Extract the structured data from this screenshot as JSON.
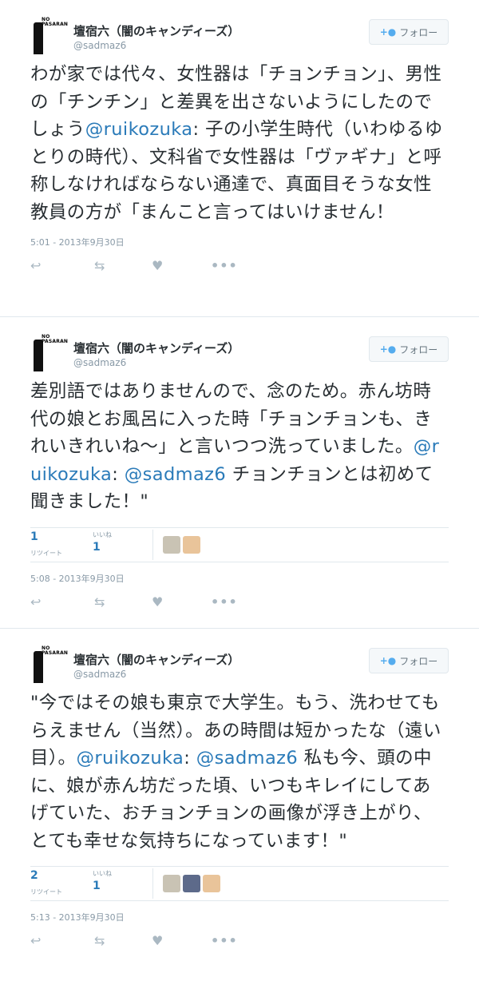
{
  "tweets": [
    {
      "name": "壇宿六（闇のキャンディーズ）",
      "handle": "@sadmaz6",
      "follow_label": "フォロー",
      "text_parts": [
        {
          "t": "わが家では代々、女性器は「チョンチョン」、男性の「チンチン」と差異を出さないようにしたのでしょう"
        },
        {
          "m": "@ruikozuka"
        },
        {
          "t": ": 子の小学生時代（いわゆるゆとりの時代）、文科省で女性器は「ヴァギナ」と呼称しなければならない通達で、真面目そうな女性教員の方が「まんこと言ってはいけません！"
        }
      ],
      "date": "5:01 - 2013年9月30日",
      "avatar_text": "NO PASARAN"
    },
    {
      "name": "壇宿六（闇のキャンディーズ）",
      "handle": "@sadmaz6",
      "follow_label": "フォロー",
      "text_parts": [
        {
          "t": "差別語ではありませんので、念のため。赤ん坊時代の娘とお風呂に入った時「チョンチョンも、きれいきれいね〜」と言いつつ洗っていました。"
        },
        {
          "m": "@ruikozuka"
        },
        {
          "t": ": "
        },
        {
          "m": "@sadmaz6"
        },
        {
          "t": " チョンチョンとは初めて聞きました！\""
        }
      ],
      "retweets": "1",
      "retweet_label": "リツイート",
      "likes": "1",
      "like_label": "いいね",
      "date": "5:08 - 2013年9月30日",
      "avatar_text": "NO PASARAN"
    },
    {
      "name": "壇宿六（闇のキャンディーズ）",
      "handle": "@sadmaz6",
      "follow_label": "フォロー",
      "text_parts": [
        {
          "t": "\"今ではその娘も東京で大学生。もう、洗わせてもらえません（当然）。あの時間は短かったな（遠い目）。"
        },
        {
          "m": "@ruikozuka"
        },
        {
          "t": ": "
        },
        {
          "m": "@sadmaz6"
        },
        {
          "t": " 私も今、頭の中に、娘が赤ん坊だった頃、いつもキレイにしてあげていた、おチョンチョンの画像が浮き上がり、とても幸せな気持ちになっています！\""
        }
      ],
      "retweets": "2",
      "retweet_label": "リツイート",
      "likes": "1",
      "like_label": "いいね",
      "date": "5:13 - 2013年9月30日",
      "avatar_text": "NO PASARAN"
    }
  ],
  "colors": {
    "link": "#2b7bb9",
    "muted": "#8899a6",
    "text": "#292f33"
  }
}
